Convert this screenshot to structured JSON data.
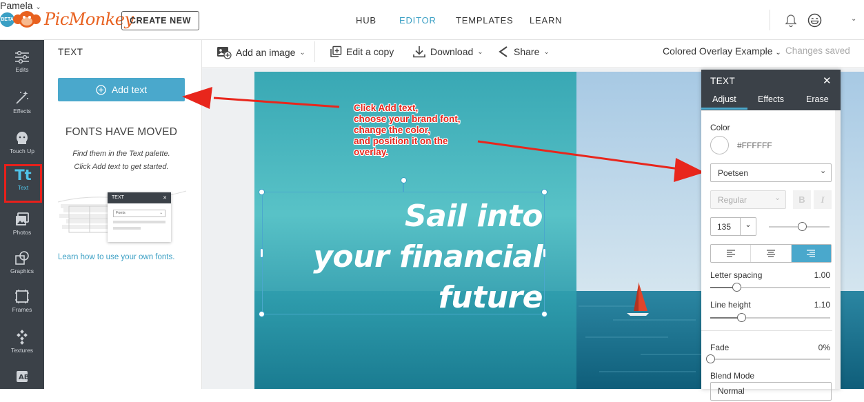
{
  "header": {
    "logo_text": "PicMonkey",
    "create_new": "CREATE NEW",
    "nav": [
      "HUB",
      "EDITOR",
      "TEMPLATES",
      "LEARN"
    ],
    "active_nav": "EDITOR",
    "user_name": "Pamela",
    "beta_badge": "BETA",
    "icons": [
      "bell-icon",
      "emoji-icon",
      "chevron-down-icon"
    ]
  },
  "left_rail": {
    "items": [
      {
        "label": "Edits",
        "icon": "sliders-icon"
      },
      {
        "label": "Effects",
        "icon": "magic-wand-icon"
      },
      {
        "label": "Touch Up",
        "icon": "face-icon"
      },
      {
        "label": "Text",
        "icon": "text-icon",
        "active": true
      },
      {
        "label": "Photos",
        "icon": "photos-icon"
      },
      {
        "label": "Graphics",
        "icon": "graphics-icon"
      },
      {
        "label": "Frames",
        "icon": "frames-icon"
      },
      {
        "label": "Textures",
        "icon": "textures-icon"
      },
      {
        "label": "",
        "icon": "overlay-icon"
      }
    ]
  },
  "palette": {
    "title": "TEXT",
    "add_text": "Add text",
    "fonts_moved_heading": "FONTS HAVE MOVED",
    "fonts_moved_line1": "Find them in the Text palette.",
    "fonts_moved_line2": "Click Add text to get started.",
    "illustration": {
      "panel_title": "TEXT",
      "dropdown": "Fonts"
    },
    "learn_link": "Learn how to use your own fonts."
  },
  "toolbar": {
    "add_image": "Add an image",
    "edit_copy": "Edit a copy",
    "download": "Download",
    "share": "Share",
    "doc_title": "Colored Overlay Example",
    "status": "Changes saved"
  },
  "canvas": {
    "line1": "Sail into",
    "line2": "your financial",
    "line3": "future",
    "colors": {
      "overlay": "#3fb6bd",
      "sky": "#b8d6ea",
      "sea": "#1f7e99",
      "sail": "#e0452b"
    }
  },
  "callout": {
    "lines": [
      "Click Add text,",
      "choose your brand font,",
      "change the color,",
      "and position it on the",
      "overlay."
    ],
    "color": "#e8261c"
  },
  "text_panel": {
    "title": "TEXT",
    "tabs": [
      "Adjust",
      "Effects",
      "Erase"
    ],
    "active_tab": "Adjust",
    "color_label": "Color",
    "color_value": "#FFFFFF",
    "font": "Poetsen",
    "style": "Regular",
    "bold": "B",
    "italic": "I",
    "size": "135",
    "size_level": 0.55,
    "align_active": "right",
    "letter_spacing_label": "Letter spacing",
    "letter_spacing_value": "1.00",
    "letter_spacing_level": 0.22,
    "line_height_label": "Line height",
    "line_height_value": "1.10",
    "line_height_level": 0.26,
    "fade_label": "Fade",
    "fade_value": "0%",
    "fade_level": 0.0,
    "blend_label": "Blend Mode",
    "blend_value": "Normal"
  }
}
